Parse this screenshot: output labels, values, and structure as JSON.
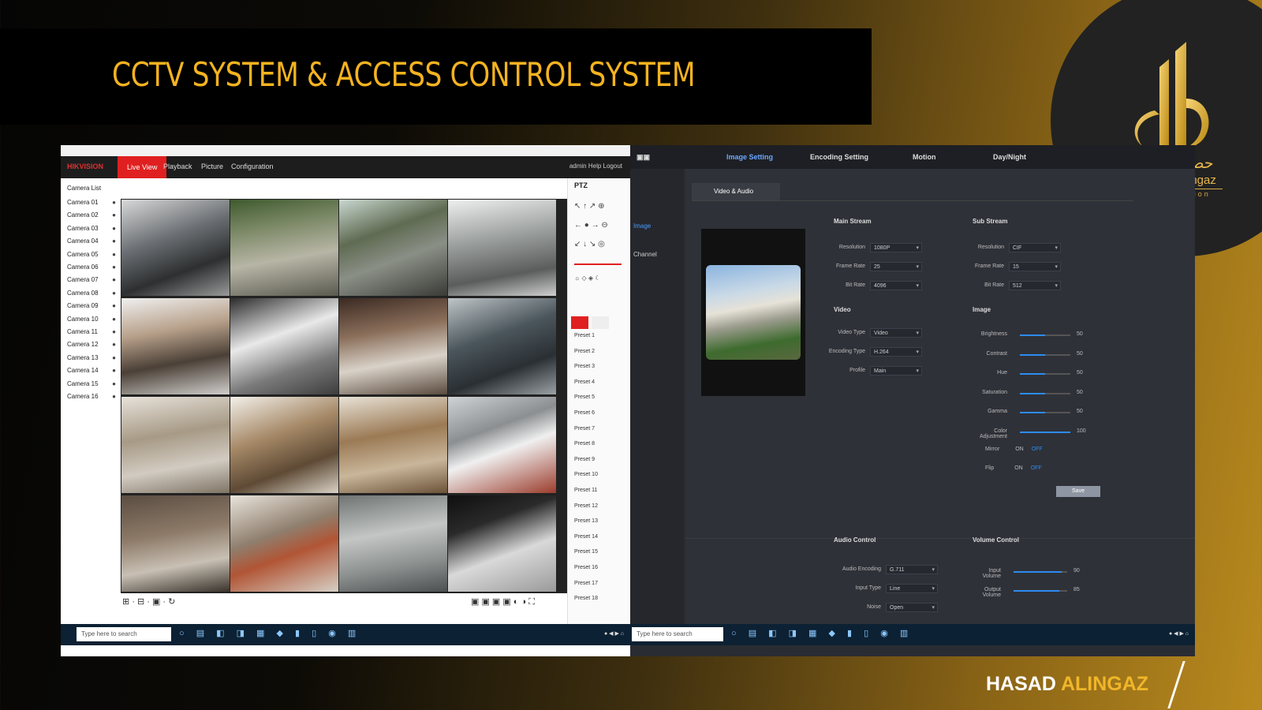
{
  "slide": {
    "title": "CCTV SYSTEM & ACCESS CONTROL SYSTEM",
    "logo": {
      "arabic": "حصاد الإنجاز",
      "english": "Hasad Al-Ingaz",
      "subtitle": "construction"
    },
    "footer": {
      "brand_part1": "HASAD",
      "brand_part2": "ALINGAZ"
    }
  },
  "colors": {
    "title_text": "#f5b320",
    "accent_gold": "#f0b62a",
    "nvr_accent": "#e02020",
    "settings_accent": "#2d8cf0"
  },
  "live_view": {
    "menu": {
      "brand": "HIKVISION",
      "tabs": [
        "Live View",
        "Playback",
        "Picture",
        "Configuration"
      ],
      "right": "admin  Help  Logout"
    },
    "camera_list_title": "Camera List",
    "cameras": [
      {
        "name": "Camera 01"
      },
      {
        "name": "Camera 02"
      },
      {
        "name": "Camera 03"
      },
      {
        "name": "Camera 04"
      },
      {
        "name": "Camera 05"
      },
      {
        "name": "Camera 06"
      },
      {
        "name": "Camera 07"
      },
      {
        "name": "Camera 08"
      },
      {
        "name": "Camera 09"
      },
      {
        "name": "Camera 10"
      },
      {
        "name": "Camera 11"
      },
      {
        "name": "Camera 12"
      },
      {
        "name": "Camera 13"
      },
      {
        "name": "Camera 14"
      },
      {
        "name": "Camera 15"
      },
      {
        "name": "Camera 16"
      }
    ],
    "ptz_title": "PTZ",
    "presets": [
      "Preset 1",
      "Preset 2",
      "Preset 3",
      "Preset 4",
      "Preset 5",
      "Preset 6",
      "Preset 7",
      "Preset 8",
      "Preset 9",
      "Preset 10",
      "Preset 11",
      "Preset 12",
      "Preset 13",
      "Preset 14",
      "Preset 15",
      "Preset 16",
      "Preset 17",
      "Preset 18"
    ],
    "taskbar_search": "Type here to search"
  },
  "settings_view": {
    "top_tabs": [
      "Image Setting",
      "Encoding Setting",
      "Motion",
      "Day/Night"
    ],
    "left_nav": [
      "Image",
      "Channel"
    ],
    "panel_tab": "Video & Audio",
    "main_stream_title": "Main Stream",
    "sub_stream_title": "Sub Stream",
    "main_rows": [
      {
        "label": "Resolution",
        "value": "1080P"
      },
      {
        "label": "Frame Rate",
        "value": "25"
      },
      {
        "label": "Bit Rate",
        "value": "4096"
      }
    ],
    "sub_rows": [
      {
        "label": "Resolution",
        "value": "CIF"
      },
      {
        "label": "Frame Rate",
        "value": "15"
      },
      {
        "label": "Bit Rate",
        "value": "512"
      }
    ],
    "video_title": "Video",
    "video_rows": [
      {
        "label": "Video Type",
        "value": "Video"
      },
      {
        "label": "Encoding Type",
        "value": "H.264"
      },
      {
        "label": "Profile",
        "value": "Main"
      }
    ],
    "image_title": "Image",
    "sliders": [
      {
        "label": "Brightness",
        "value": 50
      },
      {
        "label": "Contrast",
        "value": 50
      },
      {
        "label": "Hue",
        "value": 50
      },
      {
        "label": "Saturation",
        "value": 50
      },
      {
        "label": "Gamma",
        "value": 50
      },
      {
        "label": "Color Adjustment",
        "value": 100
      }
    ],
    "mirror_label": "Mirror",
    "flip_label": "Flip",
    "on_label": "ON",
    "off_label": "OFF",
    "save_label": "Save",
    "audio_title": "Audio Control",
    "volume_title": "Volume Control",
    "audio_rows": [
      {
        "label": "Audio Encoding",
        "value": "G.711"
      },
      {
        "label": "Input Type",
        "value": "Line"
      },
      {
        "label": "Noise",
        "value": "Open"
      }
    ],
    "volume_sliders": [
      {
        "label": "Input Volume",
        "value": 90
      },
      {
        "label": "Output Volume",
        "value": 85
      }
    ],
    "taskbar_search": "Type here to search"
  }
}
